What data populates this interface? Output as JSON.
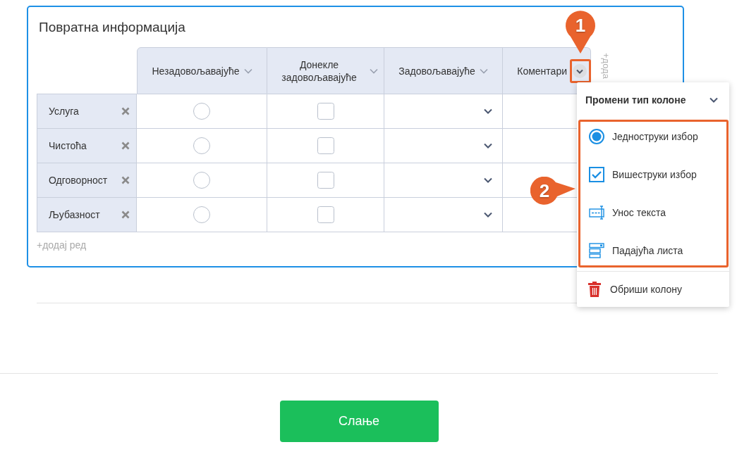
{
  "feedback_table": {
    "title": "Повратна информација",
    "columns": [
      {
        "label": "Незадовољавајуће",
        "kind": "radio",
        "menu_open": false
      },
      {
        "label": "Донекле задовољавајуће",
        "kind": "checkbox",
        "menu_open": false
      },
      {
        "label": "Задовољавајуће",
        "kind": "dropdown",
        "menu_open": false
      },
      {
        "label": "Коментари",
        "kind": "text",
        "menu_open": true
      }
    ],
    "add_column": "+дода",
    "rows": [
      {
        "label": "Услуга",
        "radio": {
          "checked": false
        },
        "checkbox": {
          "checked": false
        }
      },
      {
        "label": "Чистоћа",
        "radio": {
          "checked": false
        },
        "checkbox": {
          "checked": false
        }
      },
      {
        "label": "Одговорност",
        "radio": {
          "checked": false
        },
        "checkbox": {
          "checked": false
        }
      },
      {
        "label": "Љубазност",
        "radio": {
          "checked": false
        },
        "checkbox": {
          "checked": false
        }
      }
    ],
    "add_row": "+додај ред"
  },
  "column_menu": {
    "title": "Промени тип колоне",
    "types": [
      {
        "label": "Једноструки избор",
        "kind": "radio"
      },
      {
        "label": "Вишеструки избор",
        "kind": "checkbox"
      },
      {
        "label": "Унос текста",
        "kind": "text"
      },
      {
        "label": "Падајућа листа",
        "kind": "dropdown"
      }
    ],
    "delete": "Обриши колону"
  },
  "callouts": [
    {
      "label": "1"
    },
    {
      "label": "2"
    }
  ],
  "submit_button": "Слање"
}
